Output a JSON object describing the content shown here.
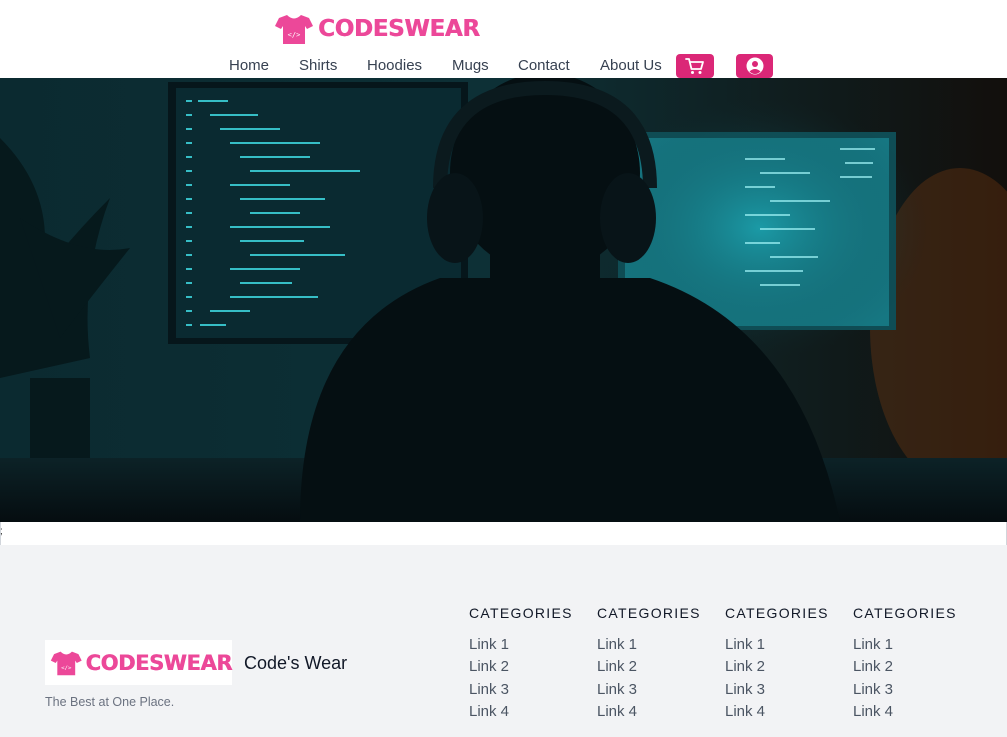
{
  "header": {
    "brand": "CODESWEAR",
    "nav": [
      {
        "label": "Home"
      },
      {
        "label": "Shirts"
      },
      {
        "label": "Hoodies"
      },
      {
        "label": "Mugs"
      },
      {
        "label": "Contact"
      },
      {
        "label": "About Us"
      }
    ],
    "cart_icon": "cart-icon",
    "account_icon": "user-circle-icon"
  },
  "hero": {
    "image": "developer-with-headphones-at-monitors"
  },
  "stray_text": ";",
  "footer": {
    "brand_logo_text": "CODESWEAR",
    "brand_name": "Code's Wear",
    "tagline": "The Best at One Place.",
    "columns": [
      {
        "title": "CATEGORIES",
        "links": [
          "Link 1",
          "Link 2",
          "Link 3",
          "Link 4"
        ]
      },
      {
        "title": "CATEGORIES",
        "links": [
          "Link 1",
          "Link 2",
          "Link 3",
          "Link 4"
        ]
      },
      {
        "title": "CATEGORIES",
        "links": [
          "Link 1",
          "Link 2",
          "Link 3",
          "Link 4"
        ]
      },
      {
        "title": "CATEGORIES",
        "links": [
          "Link 1",
          "Link 2",
          "Link 3",
          "Link 4"
        ]
      }
    ]
  },
  "colors": {
    "brand_pink": "#ec4899",
    "button_pink": "#db2777",
    "footer_bg": "#f2f3f5"
  }
}
